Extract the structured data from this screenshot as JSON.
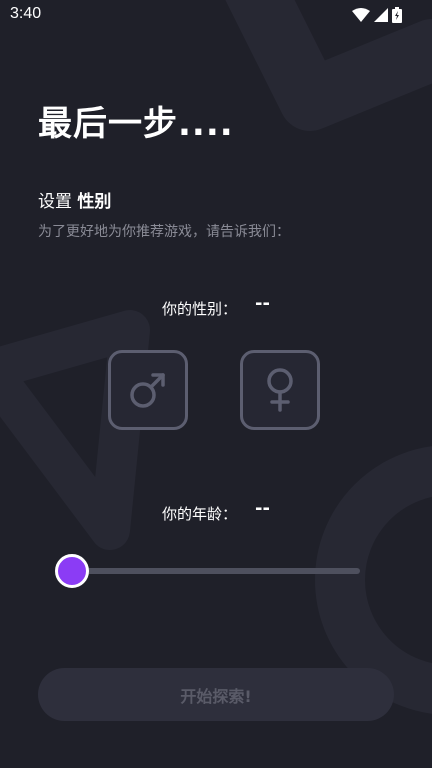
{
  "status_bar": {
    "time": "3:40"
  },
  "page": {
    "title": "最后一步....",
    "section_prefix": "设置",
    "section_strong": "性别",
    "subtitle": "为了更好地为你推荐游戏，请告诉我们："
  },
  "gender": {
    "label": "你的性别：",
    "value": "--",
    "options": [
      {
        "name": "male",
        "icon": "male-symbol"
      },
      {
        "name": "female",
        "icon": "female-symbol"
      }
    ]
  },
  "age": {
    "label": "你的年龄：",
    "value": "--",
    "slider_fraction": 0
  },
  "actions": {
    "start_label": "开始探索!"
  },
  "colors": {
    "background": "#1f2029",
    "accent": "#8b3cf5",
    "muted_text": "#8a8b96",
    "button_disabled": "#2e2f3c"
  }
}
